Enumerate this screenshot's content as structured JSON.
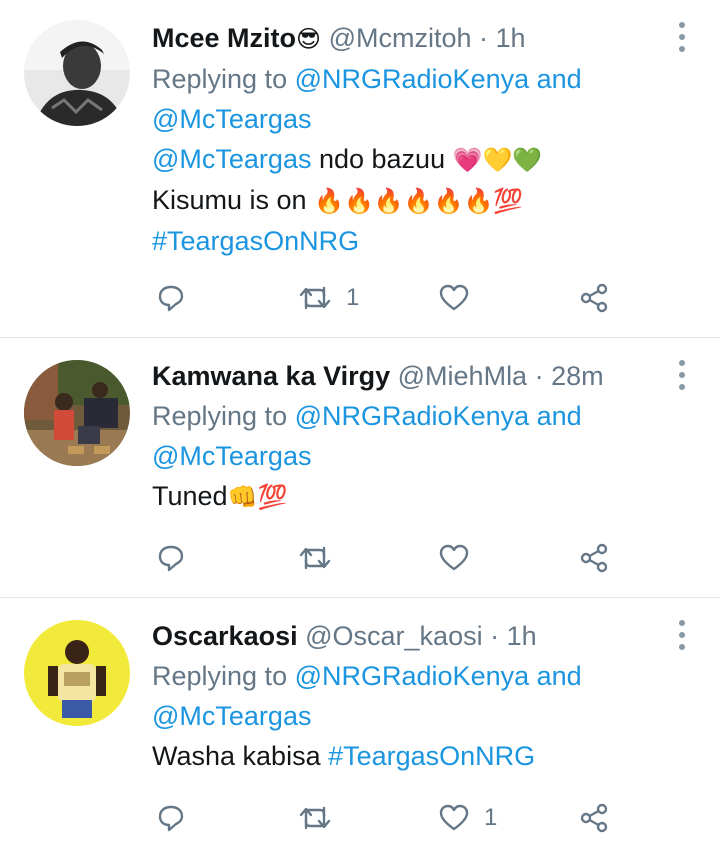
{
  "tweets": [
    {
      "name": "Mcee Mzito",
      "name_emoji": "😎",
      "handle": "@Mcmzitoh",
      "time": "· 1h",
      "reply_prefix": "Replying to",
      "reply_to_1": "@NRGRadioKenya and",
      "reply_to_2": "@McTeargas",
      "text_mention": "@McTeargas",
      "text_line1": " ndo bazuu ",
      "text_line1_emoji": "💗💛💚",
      "text_line2": "Kisumu is on ",
      "text_line2_emoji": "🔥🔥🔥🔥🔥🔥💯",
      "hashtag": "#TeargasOnNRG",
      "reply_count": "",
      "retweet_count": "1",
      "like_count": ""
    },
    {
      "name": "Kamwana ka Virgy",
      "handle": "@MiehMla",
      "time": "· 28m",
      "reply_prefix": "Replying to",
      "reply_to_1": "@NRGRadioKenya and",
      "reply_to_2": "@McTeargas",
      "text": "Tuned",
      "text_emoji": "👊💯",
      "retweet_count": "",
      "like_count": ""
    },
    {
      "name": "Oscarkaosi",
      "handle": "@Oscar_kaosi",
      "time": "· 1h",
      "reply_prefix": "Replying to",
      "reply_to_1": "@NRGRadioKenya and",
      "reply_to_2": "@McTeargas",
      "text": "Washa kabisa ",
      "hashtag": "#TeargasOnNRG",
      "retweet_count": "",
      "like_count": "1"
    }
  ],
  "colors": {
    "link": "#1b95e0",
    "muted": "#657786",
    "text": "#14171a",
    "divider": "#e1e8ed",
    "avatar3_bg": "#f2ea3a"
  },
  "icons": [
    "reply-icon",
    "retweet-icon",
    "like-icon",
    "share-icon",
    "more-options-icon"
  ]
}
